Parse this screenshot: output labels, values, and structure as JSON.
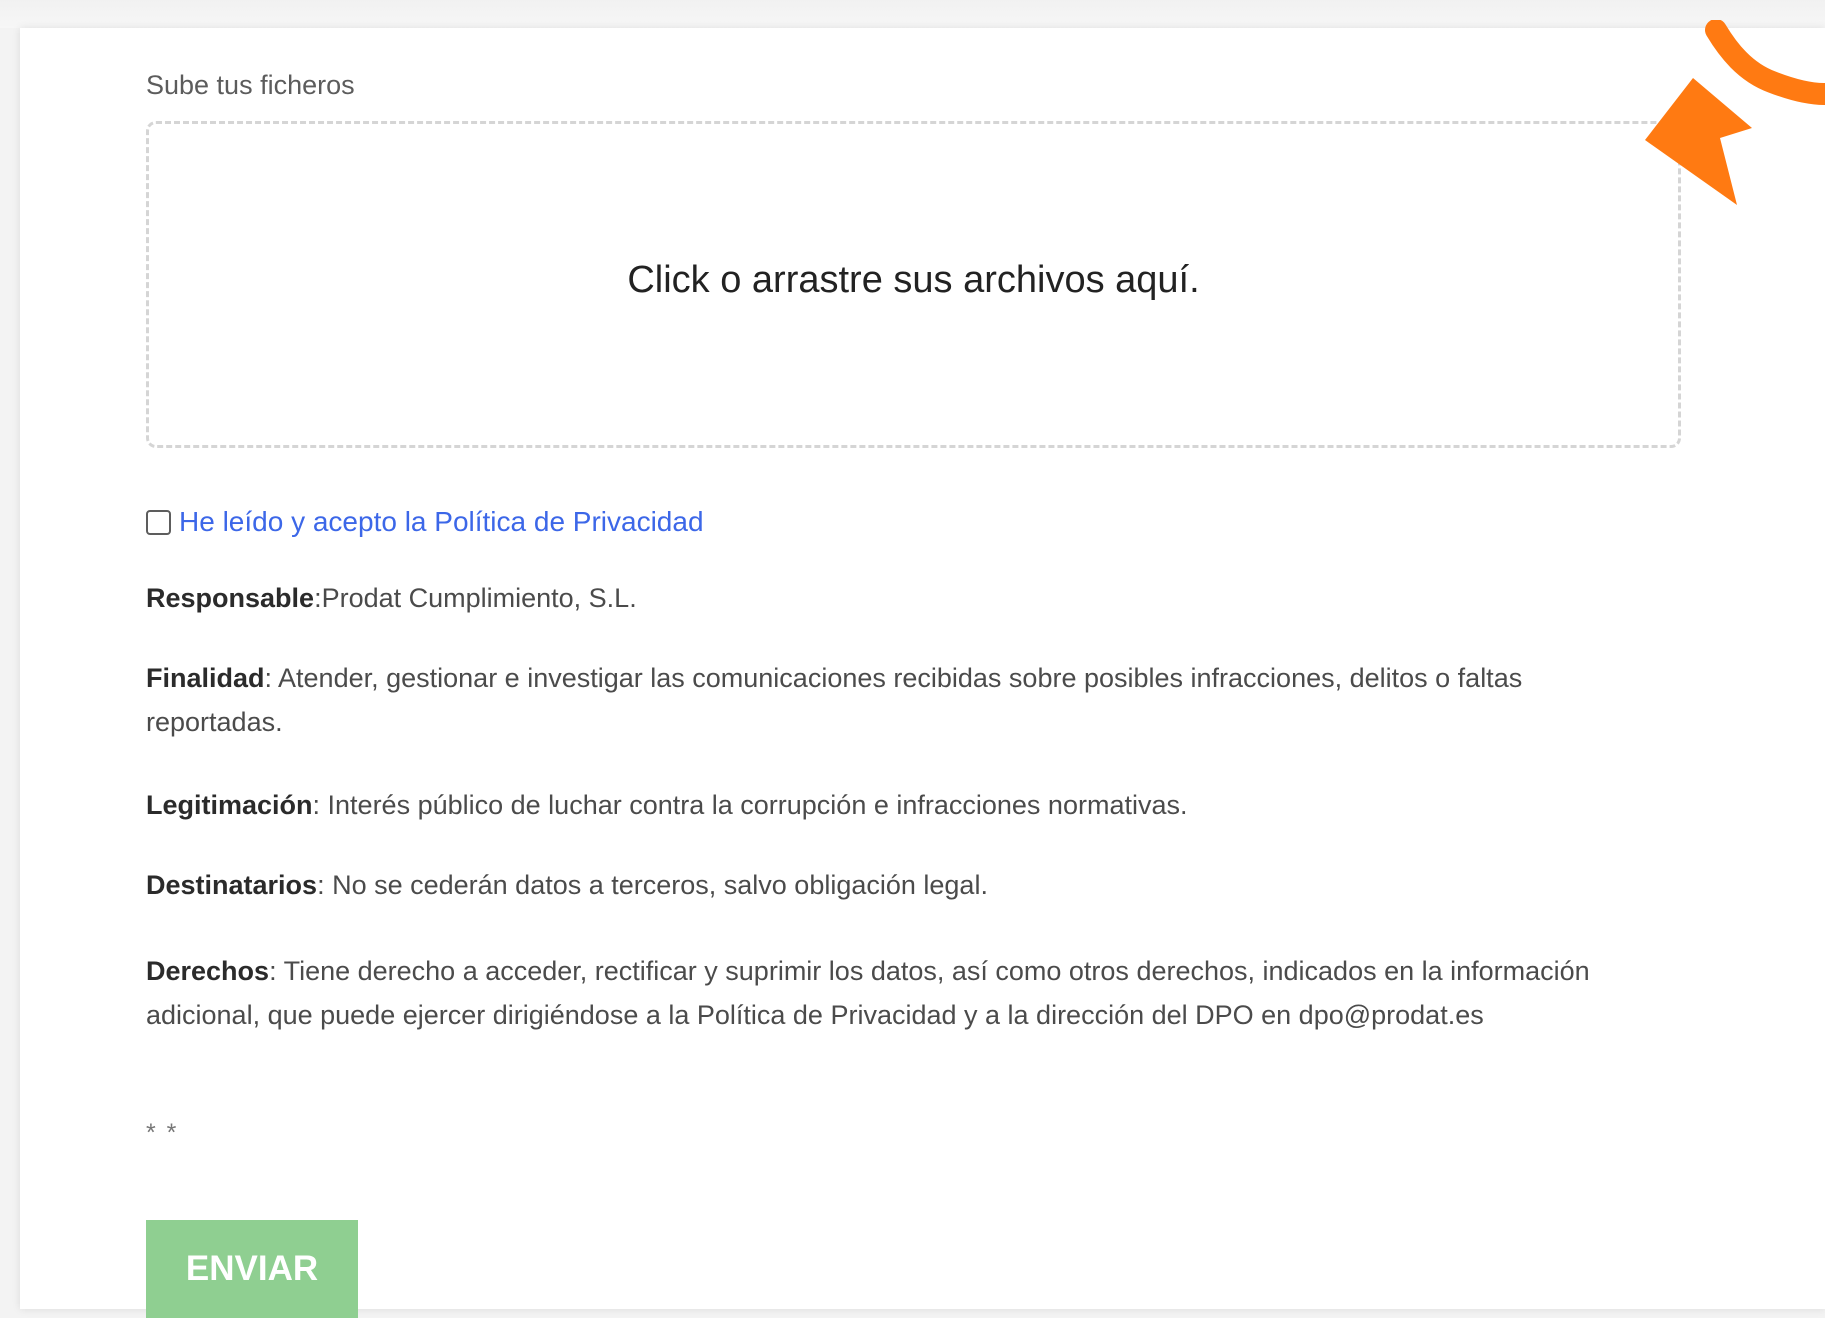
{
  "upload": {
    "label": "Sube tus ficheros",
    "dropzone_text": "Click o arrastre sus archivos aquí."
  },
  "consent": {
    "link_text": "He leído y acepto la Política de Privacidad"
  },
  "legal": {
    "responsable": {
      "title": "Responsable",
      "text": ":Prodat Cumplimiento, S.L."
    },
    "finalidad": {
      "title": "Finalidad",
      "text": ": Atender, gestionar e investigar las comunicaciones recibidas sobre posibles infracciones, delitos o faltas reportadas."
    },
    "legitimacion": {
      "title": "Legitimación",
      "text": ": Interés público de luchar contra la corrupción e infracciones normativas."
    },
    "destinatarios": {
      "title": "Destinatarios",
      "text": ": No se cederán datos a terceros, salvo obligación legal."
    },
    "derechos": {
      "title": "Derechos",
      "text": ": Tiene derecho a acceder, rectificar y suprimir los datos, así como otros derechos, indicados en la información adicional, que puede ejercer dirigiéndose a la Política de Privacidad y a la dirección del DPO en dpo@prodat.es"
    }
  },
  "asterisks": "* *",
  "submit": {
    "label": "ENVIAR"
  },
  "colors": {
    "link": "#3c67e8",
    "submit_button": "#8fcf91",
    "annotation_arrow": "#ff7a12"
  },
  "icons": {
    "annotation": "arrow-icon"
  }
}
